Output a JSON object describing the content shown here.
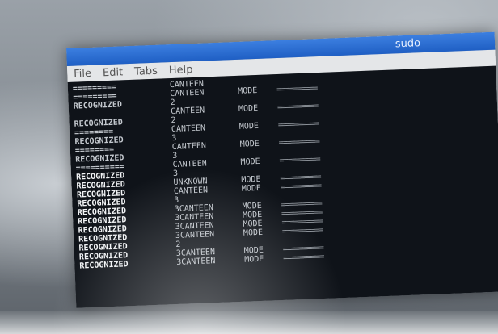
{
  "window": {
    "title": "sudo"
  },
  "menu": {
    "items": [
      "File",
      "Edit",
      "Tabs",
      "Help"
    ]
  },
  "terminal": {
    "rows": [
      [
        "=========",
        "CANTEEN",
        "",
        ""
      ],
      [
        "=========",
        "CANTEEN",
        "MODE",
        "=========="
      ],
      [
        "RECOGNIZED",
        "2",
        "",
        ""
      ],
      [
        "",
        "CANTEEN",
        "MODE",
        "=========="
      ],
      [
        "RECOGNIZED",
        "2",
        "",
        ""
      ],
      [
        "========",
        "CANTEEN",
        "MODE",
        "=========="
      ],
      [
        "RECOGNIZED",
        "3",
        "",
        ""
      ],
      [
        "========",
        "CANTEEN",
        "MODE",
        "=========="
      ],
      [
        "RECOGNIZED",
        "3",
        "",
        ""
      ],
      [
        "==========",
        "CANTEEN",
        "MODE",
        "=========="
      ],
      [
        "RECOGNIZED",
        "3",
        "",
        ""
      ],
      [
        "RECOGNIZED",
        "UNKNOWN",
        "MODE",
        "=========="
      ],
      [
        "RECOGNIZED",
        "CANTEEN",
        "MODE",
        "=========="
      ],
      [
        "RECOGNIZED",
        "3",
        "",
        ""
      ],
      [
        "RECOGNIZED",
        "3CANTEEN",
        "MODE",
        "=========="
      ],
      [
        "RECOGNIZED",
        "3CANTEEN",
        "MODE",
        "=========="
      ],
      [
        "RECOGNIZED",
        "3CANTEEN",
        "MODE",
        "=========="
      ],
      [
        "RECOGNIZED",
        "3CANTEEN",
        "MODE",
        "=========="
      ],
      [
        "RECOGNIZED",
        "2",
        "",
        ""
      ],
      [
        "RECOGNIZED",
        "3CANTEEN",
        "MODE",
        "=========="
      ],
      [
        "RECOGNIZED",
        "3CANTEEN",
        "MODE",
        "=========="
      ]
    ]
  }
}
